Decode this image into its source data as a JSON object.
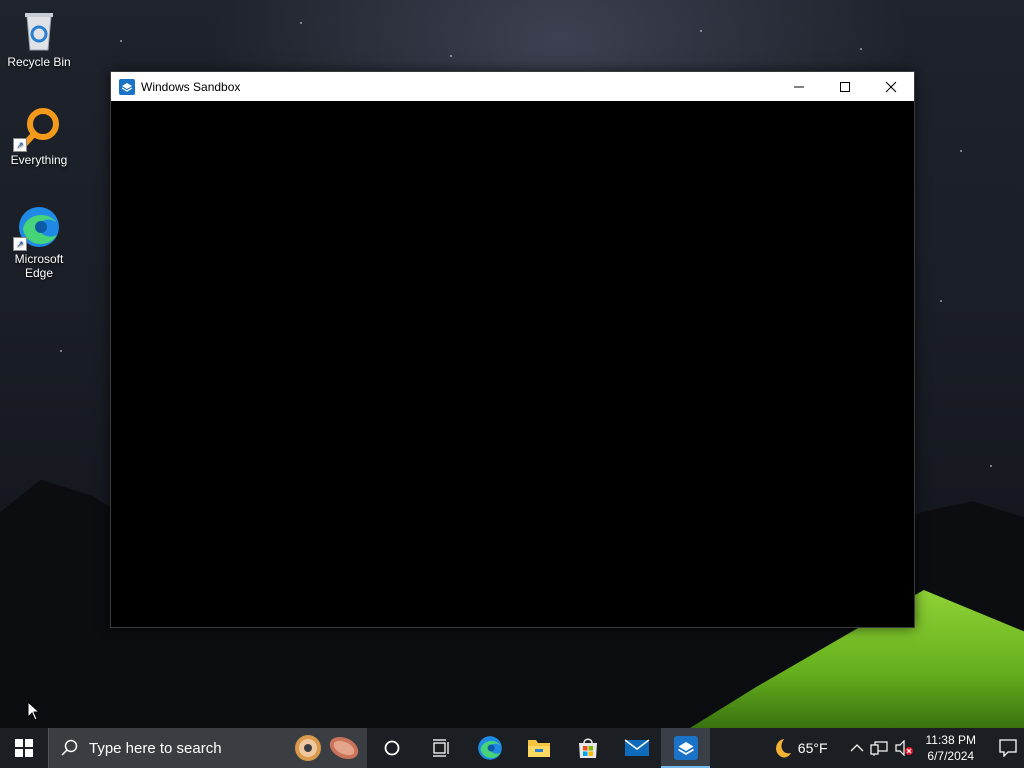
{
  "desktop": {
    "icons": [
      {
        "label": "Recycle Bin"
      },
      {
        "label": "Everything"
      },
      {
        "label": "Microsoft Edge"
      }
    ]
  },
  "window": {
    "title": "Windows Sandbox"
  },
  "taskbar": {
    "search_placeholder": "Type here to search",
    "pinned": [
      "cortana-icon",
      "task-view-icon",
      "edge-icon",
      "file-explorer-icon",
      "microsoft-store-icon",
      "mail-icon",
      "windows-sandbox-icon"
    ]
  },
  "tray": {
    "weather_temp": "65°F",
    "time": "11:38 PM",
    "date": "6/7/2024"
  },
  "colors": {
    "taskbar_bg": "#1b1f24",
    "accent": "#76b9ed"
  }
}
